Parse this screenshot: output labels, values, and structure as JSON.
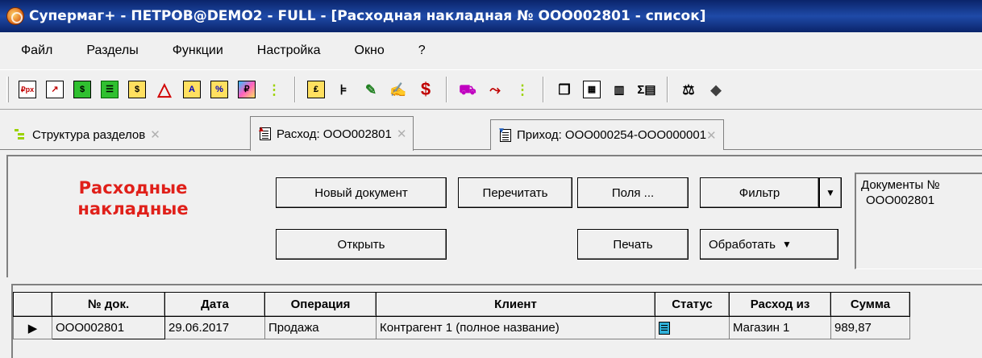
{
  "window": {
    "title": "Супермаг+ - ПЕТРОВ@DEMO2 - FULL  - [Расходная накладная № ООО002801 - список]"
  },
  "menu": {
    "items": [
      "Файл",
      "Разделы",
      "Функции",
      "Настройка",
      "Окно",
      "?"
    ]
  },
  "toolbar": {
    "icons": [
      "rpx-icon",
      "chart-icon",
      "green-doc-icon",
      "green-table-icon",
      "doc-icon",
      "triangle-icon",
      "a-doc-icon",
      "percent-doc-icon",
      "tag-icon",
      "tree-icon",
      "book-icon",
      "fork-icon",
      "pen-icon",
      "edit-doc-icon",
      "dollar-icon",
      "truck-icon",
      "route-icon",
      "tree-icon",
      "copy-icon",
      "calc-icon",
      "barcode-icon",
      "sum-icon",
      "scales-icon",
      "scanner-icon"
    ]
  },
  "tabs": [
    {
      "label": "Структура разделов",
      "icon": "tree-icon",
      "active": false
    },
    {
      "label": "Расход: ООО002801",
      "icon": "doc-out-icon",
      "active": true
    },
    {
      "label": "Приход: ООО000254-ООО000001",
      "icon": "doc-in-icon",
      "active": false
    }
  ],
  "panel": {
    "heading_line1": "Расходные",
    "heading_line2": "накладные",
    "buttons": {
      "new": "Новый документ",
      "reread": "Перечитать",
      "fields": "Поля ...",
      "filter": "Фильтр",
      "open": "Открыть",
      "print": "Печать",
      "process": "Обработать"
    },
    "info_label": "Документы №",
    "info_value": "ООО002801"
  },
  "grid": {
    "columns": [
      "№ док.",
      "Дата",
      "Операция",
      "Клиент",
      "Статус",
      "Расход из",
      "Сумма"
    ],
    "rows": [
      {
        "doc_no": "ООО002801",
        "date": "29.06.2017",
        "operation": "Продажа",
        "client": "Контрагент 1 (полное название)",
        "status_icon": "document-status-icon",
        "source": "Магазин 1",
        "sum": "989,87"
      }
    ]
  },
  "colors": {
    "titlebar": "#0a246a",
    "heading": "#e0201a",
    "status": "#30b0d8"
  }
}
